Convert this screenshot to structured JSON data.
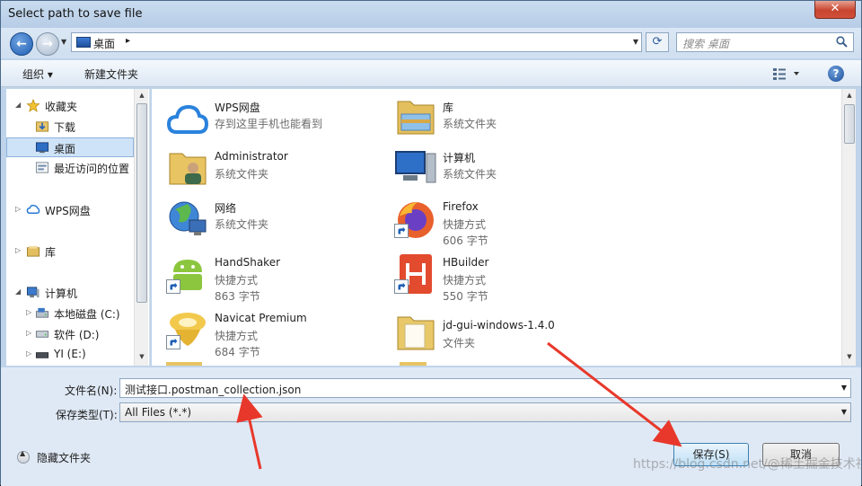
{
  "window": {
    "title": "Select path to save file",
    "close_glyph": "✕"
  },
  "navbar": {
    "back_glyph": "←",
    "forward_glyph": "→",
    "address_path": "桌面",
    "address_separator": "▸",
    "search_placeholder": "搜索 桌面",
    "refresh_glyph": "⟳"
  },
  "toolbar": {
    "organize_label": "组织 ▾",
    "new_folder_label": "新建文件夹",
    "help_glyph": "?"
  },
  "sidebar": {
    "items": [
      {
        "label": "收藏夹",
        "icon": "star-icon",
        "arrow": "◢"
      },
      {
        "label": "下载",
        "icon": "download-folder-icon"
      },
      {
        "label": "桌面",
        "icon": "desktop-icon",
        "selected": true
      },
      {
        "label": "最近访问的位置",
        "icon": "recent-places-icon"
      },
      {
        "label": "WPS网盘",
        "icon": "cloud-icon",
        "arrow": "▷"
      },
      {
        "label": "库",
        "icon": "library-icon",
        "arrow": "▷"
      },
      {
        "label": "计算机",
        "icon": "computer-icon",
        "arrow": "◢"
      },
      {
        "label": "本地磁盘 (C:)",
        "icon": "disk-icon",
        "arrow": "▷"
      },
      {
        "label": "软件 (D:)",
        "icon": "disk-icon",
        "arrow": "▷"
      },
      {
        "label": "YI (E:)",
        "icon": "disk-icon",
        "arrow": "▷"
      }
    ]
  },
  "files": {
    "left": [
      {
        "name": "WPS网盘",
        "sub1": "存到这里手机也能看到",
        "sub2": "",
        "icon": "wps-cloud-icon",
        "shortcut": false
      },
      {
        "name": "Administrator",
        "sub1": "系统文件夹",
        "sub2": "",
        "icon": "user-folder-icon",
        "shortcut": false
      },
      {
        "name": "网络",
        "sub1": "系统文件夹",
        "sub2": "",
        "icon": "network-globe-icon",
        "shortcut": false
      },
      {
        "name": "HandShaker",
        "sub1": "快捷方式",
        "sub2": "863 字节",
        "icon": "android-icon",
        "shortcut": true
      },
      {
        "name": "Navicat Premium",
        "sub1": "快捷方式",
        "sub2": "684 字节",
        "icon": "navicat-icon",
        "shortcut": true
      }
    ],
    "right": [
      {
        "name": "库",
        "sub1": "系统文件夹",
        "sub2": "",
        "icon": "library-folder-icon",
        "shortcut": false
      },
      {
        "name": "计算机",
        "sub1": "系统文件夹",
        "sub2": "",
        "icon": "computer-monitor-icon",
        "shortcut": false
      },
      {
        "name": "Firefox",
        "sub1": "快捷方式",
        "sub2": "606 字节",
        "icon": "firefox-icon",
        "shortcut": true
      },
      {
        "name": "HBuilder",
        "sub1": "快捷方式",
        "sub2": "550 字节",
        "icon": "hbuilder-icon",
        "shortcut": true
      },
      {
        "name": "jd-gui-windows-1.4.0",
        "sub1": "文件夹",
        "sub2": "",
        "icon": "folder-icon",
        "shortcut": false
      }
    ]
  },
  "form": {
    "filename_label": "文件名(N):",
    "filename_value": "测试接口.postman_collection.json",
    "filetype_label": "保存类型(T):",
    "filetype_value": "All Files (*.*)",
    "hide_folders_label": "隐藏文件夹",
    "save_label": "保存(S)",
    "cancel_label": "取消"
  },
  "watermark": "https://blog.csdn.net/@稀土掘金技术社区",
  "colors": {
    "annotation_arrow": "#e8382b",
    "selection": "#cfe3f8"
  }
}
